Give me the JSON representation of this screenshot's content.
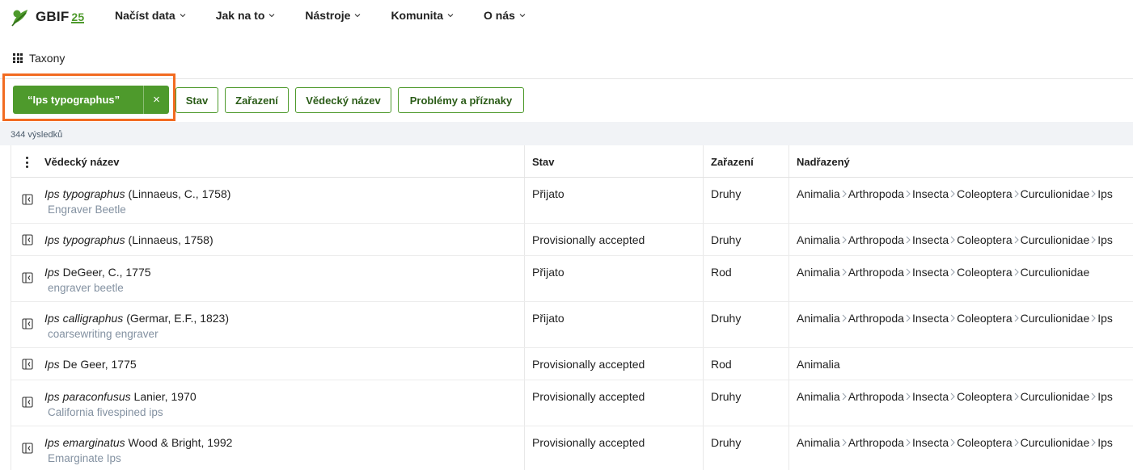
{
  "brand": {
    "name": "GBIF",
    "badge": "25"
  },
  "nav": [
    {
      "label": "Načíst data"
    },
    {
      "label": "Jak na to"
    },
    {
      "label": "Nástroje"
    },
    {
      "label": "Komunita"
    },
    {
      "label": "O nás"
    }
  ],
  "breadcrumb": {
    "label": "Taxony"
  },
  "filters": {
    "active": {
      "label": "“Ips typographus”",
      "clear": "×"
    },
    "chips": [
      {
        "label": "Stav"
      },
      {
        "label": "Zařazení"
      },
      {
        "label": "Vědecký název"
      },
      {
        "label": "Problémy a příznaky"
      }
    ]
  },
  "results": {
    "count_text": "344 výsledků"
  },
  "table": {
    "headers": {
      "name": "Vědecký název",
      "status": "Stav",
      "rank": "Zařazení",
      "parents": "Nadřazený"
    },
    "rows": [
      {
        "genus": "Ips",
        "epithet": "typographus",
        "author": "(Linnaeus, C., 1758)",
        "vernacular": "Engraver Beetle",
        "status": "Přijato",
        "rank": "Druhy",
        "parents": [
          "Animalia",
          "Arthropoda",
          "Insecta",
          "Coleoptera",
          "Curculionidae",
          "Ips"
        ]
      },
      {
        "genus": "Ips",
        "epithet": "typographus",
        "author": "(Linnaeus, 1758)",
        "vernacular": "",
        "status": "Provisionally accepted",
        "rank": "Druhy",
        "parents": [
          "Animalia",
          "Arthropoda",
          "Insecta",
          "Coleoptera",
          "Curculionidae",
          "Ips"
        ]
      },
      {
        "genus": "Ips",
        "epithet": "",
        "author": "DeGeer, C., 1775",
        "vernacular": "engraver beetle",
        "status": "Přijato",
        "rank": "Rod",
        "parents": [
          "Animalia",
          "Arthropoda",
          "Insecta",
          "Coleoptera",
          "Curculionidae"
        ]
      },
      {
        "genus": "Ips",
        "epithet": "calligraphus",
        "author": "(Germar, E.F., 1823)",
        "vernacular": "coarsewriting engraver",
        "status": "Přijato",
        "rank": "Druhy",
        "parents": [
          "Animalia",
          "Arthropoda",
          "Insecta",
          "Coleoptera",
          "Curculionidae",
          "Ips"
        ]
      },
      {
        "genus": "Ips",
        "epithet": "",
        "author": "De Geer, 1775",
        "vernacular": "",
        "status": "Provisionally accepted",
        "rank": "Rod",
        "parents": [
          "Animalia"
        ]
      },
      {
        "genus": "Ips",
        "epithet": "paraconfusus",
        "author": "Lanier, 1970",
        "vernacular": "California fivespined ips",
        "status": "Provisionally accepted",
        "rank": "Druhy",
        "parents": [
          "Animalia",
          "Arthropoda",
          "Insecta",
          "Coleoptera",
          "Curculionidae",
          "Ips"
        ]
      },
      {
        "genus": "Ips",
        "epithet": "emarginatus",
        "author": "Wood & Bright, 1992",
        "vernacular": "Emarginate Ips",
        "status": "Provisionally accepted",
        "rank": "Druhy",
        "parents": [
          "Animalia",
          "Arthropoda",
          "Insecta",
          "Coleoptera",
          "Curculionidae",
          "Ips"
        ]
      }
    ]
  },
  "colors": {
    "accent": "#4e9a2c",
    "highlight": "#f26b21",
    "muted_text": "#8391a1"
  },
  "icons": {
    "row_expand": "panel-expand-icon",
    "parent_separator": "chevron-right-icon",
    "menu": "apps-grid-icon"
  }
}
